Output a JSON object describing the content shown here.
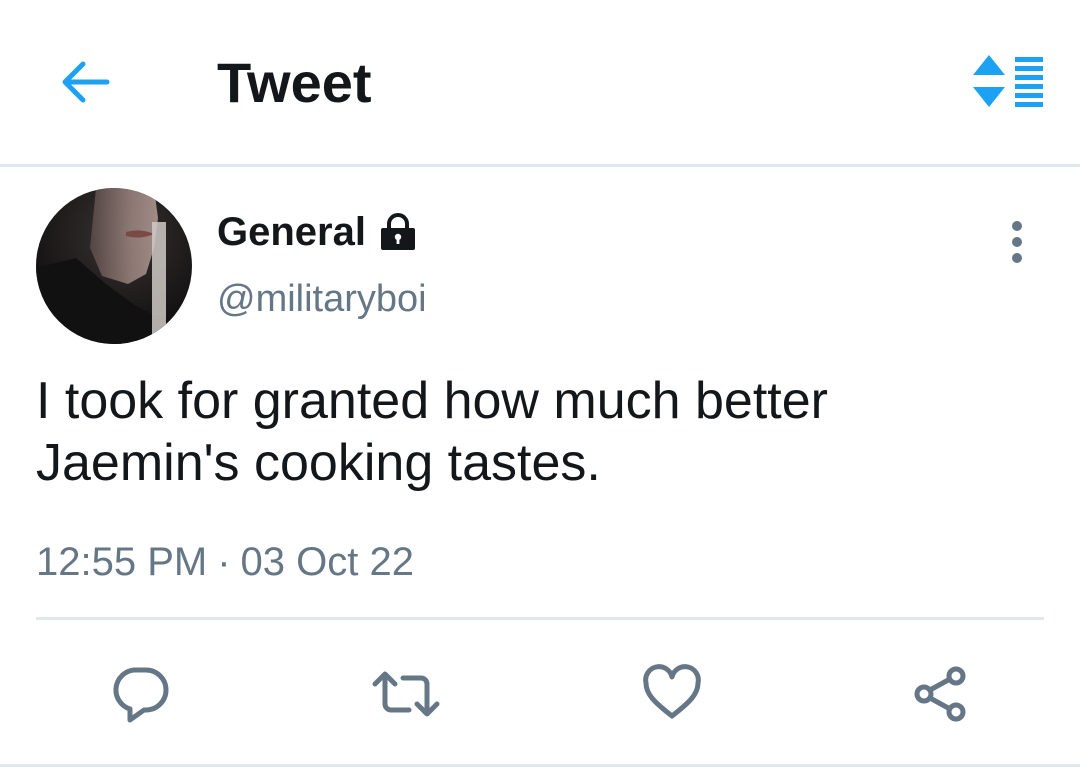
{
  "header": {
    "title": "Tweet",
    "back_icon": "arrow-left-icon",
    "sort_icon": "sort-order-icon",
    "accent_color": "#1da1f2"
  },
  "author": {
    "display_name": "General",
    "handle": "@militaryboi",
    "protected_icon": "lock-icon",
    "avatar_icon": "profile-photo"
  },
  "tweet": {
    "text": "I took for granted how much better Jaemin's cooking tastes.",
    "time": "12:55 PM",
    "separator": "·",
    "date": "03 Oct 22"
  },
  "actions": [
    {
      "name": "reply",
      "icon": "reply-icon"
    },
    {
      "name": "retweet",
      "icon": "retweet-icon"
    },
    {
      "name": "like",
      "icon": "heart-icon"
    },
    {
      "name": "share",
      "icon": "share-icon"
    }
  ],
  "colors": {
    "text_primary": "#14171a",
    "text_secondary": "#657786",
    "divider": "#e1e8ed",
    "icon_gray": "#657786"
  }
}
